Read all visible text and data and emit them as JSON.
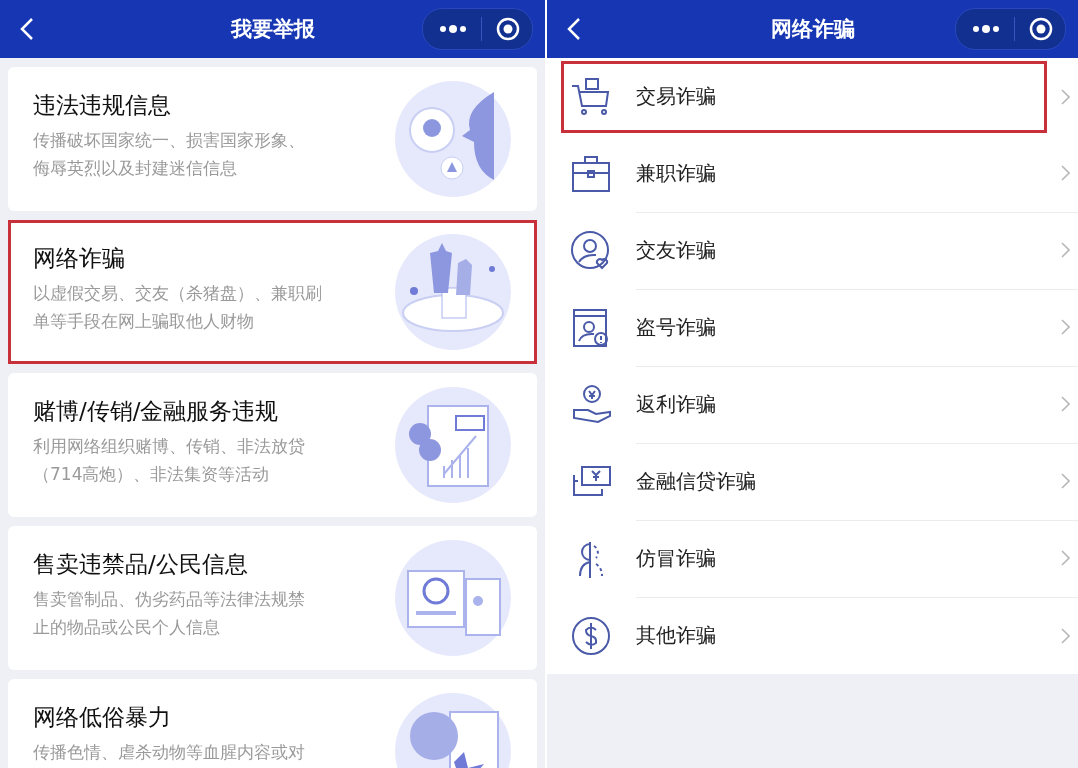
{
  "left_screen": {
    "title": "我要举报",
    "cards": [
      {
        "title": "违法违规信息",
        "description_lines": [
          "传播破坏国家统一、损害国家形象、",
          "侮辱英烈以及封建迷信信息"
        ],
        "highlighted": false
      },
      {
        "title": "网络诈骗",
        "description_lines": [
          "以虚假交易、交友（杀猪盘）、兼职刷",
          "单等手段在网上骗取他人财物"
        ],
        "highlighted": true
      },
      {
        "title": "赌博/传销/金融服务违规",
        "description_lines": [
          "利用网络组织赌博、传销、非法放贷",
          "（714高炮）、非法集资等活动"
        ],
        "highlighted": false
      },
      {
        "title": "售卖违禁品/公民信息",
        "description_lines": [
          "售卖管制品、伪劣药品等法律法规禁",
          "止的物品或公民个人信息"
        ],
        "highlighted": false
      },
      {
        "title": "网络低俗暴力",
        "description_lines": [
          "传播色情、虐杀动物等血腥内容或对"
        ],
        "highlighted": false
      }
    ]
  },
  "right_screen": {
    "title": "网络诈骗",
    "items": [
      {
        "label": "交易诈骗",
        "highlighted": true
      },
      {
        "label": "兼职诈骗",
        "highlighted": false
      },
      {
        "label": "交友诈骗",
        "highlighted": false
      },
      {
        "label": "盗号诈骗",
        "highlighted": false
      },
      {
        "label": "返利诈骗",
        "highlighted": false
      },
      {
        "label": "金融信贷诈骗",
        "highlighted": false
      },
      {
        "label": "仿冒诈骗",
        "highlighted": false
      },
      {
        "label": "其他诈骗",
        "highlighted": false
      }
    ]
  }
}
